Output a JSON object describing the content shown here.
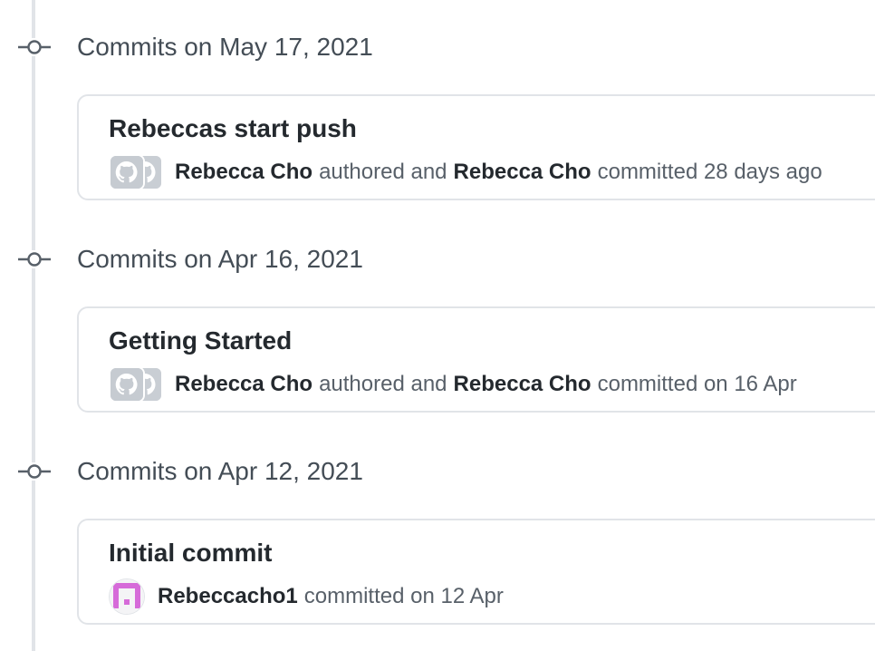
{
  "groups": [
    {
      "date_label": "Commits on May 17, 2021",
      "commit": {
        "title": "Rebeccas start push",
        "author": "Rebecca Cho",
        "authored_text": "authored and",
        "committer": "Rebecca Cho",
        "committed_text": "committed 28 days ago",
        "avatar": "github-avatar-icon"
      }
    },
    {
      "date_label": "Commits on Apr 16, 2021",
      "commit": {
        "title": "Getting Started",
        "author": "Rebecca Cho",
        "authored_text": "authored and",
        "committer": "Rebecca Cho",
        "committed_text": "committed on 16 Apr",
        "avatar": "github-avatar-icon"
      }
    },
    {
      "date_label": "Commits on Apr 12, 2021",
      "commit": {
        "title": "Initial commit",
        "committer": "Rebeccacho1",
        "committed_text": "committed on 12 Apr",
        "avatar": "identicon-avatar",
        "avatar_color": "#d66bd9"
      }
    }
  ],
  "colors": {
    "timeline": "#e1e4e8",
    "border": "#e1e4e8",
    "text_muted": "#586069",
    "text_strong": "#24292e"
  }
}
